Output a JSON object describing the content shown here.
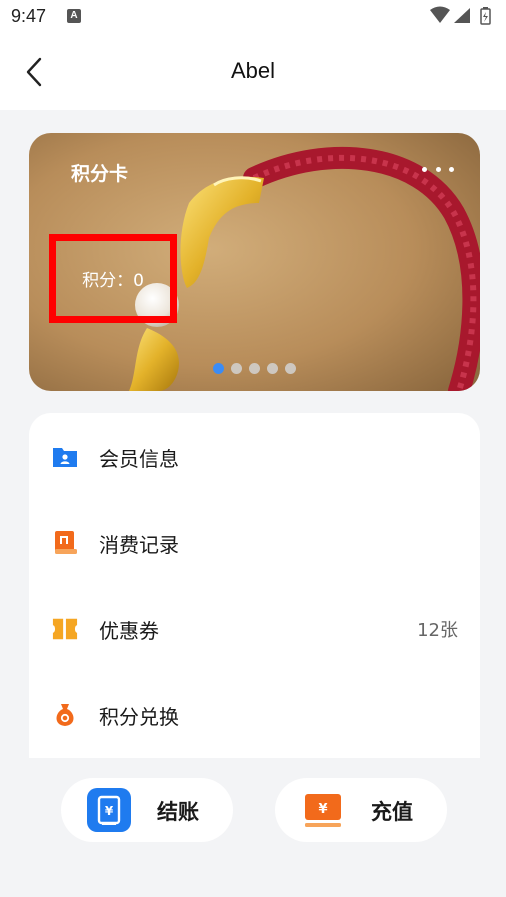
{
  "status_bar": {
    "time": "9:47",
    "notification_glyph": "A",
    "icons": [
      "wifi-icon",
      "signal-icon",
      "battery-icon"
    ]
  },
  "header": {
    "title": "Abel",
    "back_icon": "chevron-left-icon"
  },
  "card": {
    "title": "积分卡",
    "points_text": "积分：0",
    "slide_count": 5,
    "active_slide": 1,
    "highlight_color": "#ff0000",
    "dot_active_color": "#3b8cf5"
  },
  "menu": {
    "items": [
      {
        "label": "会员信息",
        "icon": "member-card-icon",
        "value": ""
      },
      {
        "label": "消费记录",
        "icon": "receipt-icon",
        "value": ""
      },
      {
        "label": "优惠券",
        "icon": "coupon-icon",
        "value": "12张"
      },
      {
        "label": "积分兑换",
        "icon": "money-bag-icon",
        "value": ""
      }
    ]
  },
  "actions": {
    "checkout": {
      "label": "结账",
      "icon": "checkout-icon",
      "color": "#1f7bef"
    },
    "recharge": {
      "label": "充值",
      "icon": "recharge-icon",
      "color": "#f26a1b"
    }
  }
}
